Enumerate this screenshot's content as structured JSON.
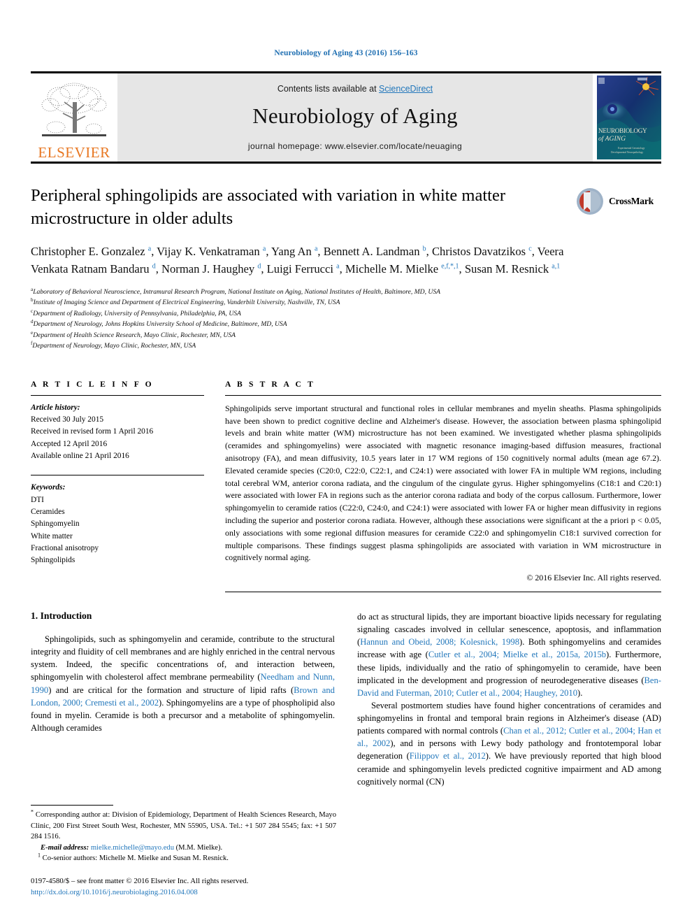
{
  "running_head": "Neurobiology of Aging 43 (2016) 156–163",
  "masthead": {
    "publisher": "ELSEVIER",
    "contents_prefix": "Contents lists available at ",
    "contents_link": "ScienceDirect",
    "journal_name": "Neurobiology of Aging",
    "homepage": "journal homepage: www.elsevier.com/locate/neuaging",
    "cover_title_line1": "NEUROBIOLOGY",
    "cover_title_line2": "of AGING",
    "cover_subtitle": "Experimental Gerontology",
    "cover_subtitle2": "Developmental Neuropathology"
  },
  "article": {
    "title": "Peripheral sphingolipids are associated with variation in white matter microstructure in older adults",
    "crossmark_label": "CrossMark",
    "authors_html": "Christopher E. Gonzalez <sup>a</sup>, Vijay K. Venkatraman <sup>a</sup>, Yang An <sup>a</sup>, Bennett A. Landman <sup>b</sup>, Christos Davatzikos <sup>c</sup>, Veera Venkata Ratnam Bandaru <sup>d</sup>, Norman J. Haughey <sup>d</sup>, Luigi Ferrucci <sup>a</sup>, Michelle M. Mielke <sup>e,f,*,1</sup>, Susan M. Resnick <sup>a,1</sup>",
    "affiliations": [
      {
        "mark": "a",
        "text": "Laboratory of Behavioral Neuroscience, Intramural Research Program, National Institute on Aging, National Institutes of Health, Baltimore, MD, USA"
      },
      {
        "mark": "b",
        "text": "Institute of Imaging Science and Department of Electrical Engineering, Vanderbilt University, Nashville, TN, USA"
      },
      {
        "mark": "c",
        "text": "Department of Radiology, University of Pennsylvania, Philadelphia, PA, USA"
      },
      {
        "mark": "d",
        "text": "Department of Neurology, Johns Hopkins University School of Medicine, Baltimore, MD, USA"
      },
      {
        "mark": "e",
        "text": "Department of Health Science Research, Mayo Clinic, Rochester, MN, USA"
      },
      {
        "mark": "f",
        "text": "Department of Neurology, Mayo Clinic, Rochester, MN, USA"
      }
    ]
  },
  "article_info": {
    "heading": "A R T I C L E    I N F O",
    "history_label": "Article history:",
    "history": [
      "Received 30 July 2015",
      "Received in revised form 1 April 2016",
      "Accepted 12 April 2016",
      "Available online 21 April 2016"
    ],
    "keywords_label": "Keywords:",
    "keywords": [
      "DTI",
      "Ceramides",
      "Sphingomyelin",
      "White matter",
      "Fractional anisotropy",
      "Sphingolipids"
    ]
  },
  "abstract": {
    "heading": "A B S T R A C T",
    "text": "Sphingolipids serve important structural and functional roles in cellular membranes and myelin sheaths. Plasma sphingolipids have been shown to predict cognitive decline and Alzheimer's disease. However, the association between plasma sphingolipid levels and brain white matter (WM) microstructure has not been examined. We investigated whether plasma sphingolipids (ceramides and sphingomyelins) were associated with magnetic resonance imaging-based diffusion measures, fractional anisotropy (FA), and mean diffusivity, 10.5 years later in 17 WM regions of 150 cognitively normal adults (mean age 67.2). Elevated ceramide species (C20:0, C22:0, C22:1, and C24:1) were associated with lower FA in multiple WM regions, including total cerebral WM, anterior corona radiata, and the cingulum of the cingulate gyrus. Higher sphingomyelins (C18:1 and C20:1) were associated with lower FA in regions such as the anterior corona radiata and body of the corpus callosum. Furthermore, lower sphingomyelin to ceramide ratios (C22:0, C24:0, and C24:1) were associated with lower FA or higher mean diffusivity in regions including the superior and posterior corona radiata. However, although these associations were significant at the a priori p < 0.05, only associations with some regional diffusion measures for ceramide C22:0 and sphingomyelin C18:1 survived correction for multiple comparisons. These findings suggest plasma sphingolipids are associated with variation in WM microstructure in cognitively normal aging.",
    "copyright": "© 2016 Elsevier Inc. All rights reserved."
  },
  "introduction": {
    "heading": "1. Introduction",
    "left_para_1_html": "Sphingolipids, such as sphingomyelin and ceramide, contribute to the structural integrity and fluidity of cell membranes and are highly enriched in the central nervous system. Indeed, the specific concentrations of, and interaction between, sphingomyelin with cholesterol affect membrane permeability (<span class=\"ref\">Needham and Nunn, 1990</span>) and are critical for the formation and structure of lipid rafts (<span class=\"ref\">Brown and London, 2000; Cremesti et al., 2002</span>). Sphingomyelins are a type of phospholipid also found in myelin. Ceramide is both a precursor and a metabolite of sphingomyelin. Although ceramides",
    "right_para_1_html": "do act as structural lipids, they are important bioactive lipids necessary for regulating signaling cascades involved in cellular senescence, apoptosis, and inflammation (<span class=\"ref\">Hannun and Obeid, 2008; Kolesnick, 1998</span>). Both sphingomyelins and ceramides increase with age (<span class=\"ref\">Cutler et al., 2004; Mielke et al., 2015a, 2015b</span>). Furthermore, these lipids, individually and the ratio of sphingomyelin to ceramide, have been implicated in the development and progression of neurodegenerative diseases (<span class=\"ref\">Ben-David and Futerman, 2010; Cutler et al., 2004; Haughey, 2010</span>).",
    "right_para_2_html": "Several postmortem studies have found higher concentrations of ceramides and sphingomyelins in frontal and temporal brain regions in Alzheimer's disease (AD) patients compared with normal controls (<span class=\"ref\">Chan et al., 2012; Cutler et al., 2004; Han et al., 2002</span>), and in persons with Lewy body pathology and frontotemporal lobar degeneration (<span class=\"ref\">Filippov et al., 2012</span>). We have previously reported that high blood ceramide and sphingomyelin levels predicted cognitive impairment and AD among cognitively normal (CN)"
  },
  "footnotes": {
    "corresponding_html": "<sup>*</sup> Corresponding author at: Division of Epidemiology, Department of Health Sciences Research, Mayo Clinic, 200 First Street South West, Rochester, MN 55905, USA. Tel.: +1 507 284 5545; fax: +1 507 284 1516.",
    "email_html": "<span class=\"ital\">E-mail address:</span> <span class=\"ref\">mielke.michelle@mayo.edu</span> (M.M. Mielke).",
    "cosenior_html": "<sup>1</sup> Co-senior authors: Michelle M. Mielke and Susan M. Resnick.",
    "issn_line": "0197-4580/$ – see front matter © 2016 Elsevier Inc. All rights reserved.",
    "doi_line": "http://dx.doi.org/10.1016/j.neurobiolaging.2016.04.008"
  },
  "colors": {
    "link_blue": "#2277bb",
    "running_head_blue": "#1f6fb2",
    "elsevier_orange": "#E87722",
    "masthead_gray": "#e6e6e6"
  }
}
